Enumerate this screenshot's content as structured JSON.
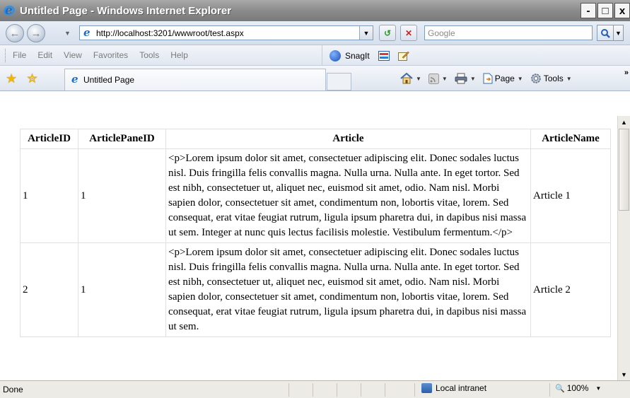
{
  "window": {
    "title": "Untitled Page - Windows Internet Explorer",
    "controls": [
      "-",
      "□",
      "x"
    ]
  },
  "address": {
    "url": "http://localhost:3201/wwwroot/test.aspx",
    "search_placeholder": "Google"
  },
  "menu": {
    "items": [
      "File",
      "Edit",
      "View",
      "Favorites",
      "Tools",
      "Help"
    ],
    "snagit": "SnagIt"
  },
  "favorites": {
    "tab_label": "Untitled Page",
    "page_label": "Page",
    "tools_label": "Tools",
    "more": "»"
  },
  "table": {
    "headers": [
      "ArticleID",
      "ArticlePaneID",
      "Article",
      "ArticleName"
    ],
    "rows": [
      {
        "id": "1",
        "pane": "1",
        "article": "<p>Lorem ipsum dolor sit amet, consectetuer adipiscing elit. Donec sodales luctus nisl. Duis fringilla felis convallis magna. Nulla urna. Nulla ante. In eget tortor. Sed est nibh, consectetuer ut, aliquet nec, euismod sit amet, odio. Nam nisl. Morbi sapien dolor, consectetuer sit amet, condimentum non, lobortis vitae, lorem. Sed consequat, erat vitae feugiat rutrum, ligula ipsum pharetra dui, in dapibus nisi massa ut sem. Integer at nunc quis lectus facilisis molestie. Vestibulum fermentum.</p>",
        "name": "Article 1"
      },
      {
        "id": "2",
        "pane": "1",
        "article": "<p>Lorem ipsum dolor sit amet, consectetuer adipiscing elit. Donec sodales luctus nisl. Duis fringilla felis convallis magna. Nulla urna. Nulla ante. In eget tortor. Sed est nibh, consectetuer ut, aliquet nec, euismod sit amet, odio. Nam nisl. Morbi sapien dolor, consectetuer sit amet, condimentum non, lobortis vitae, lorem. Sed consequat, erat vitae feugiat rutrum, ligula ipsum pharetra dui, in dapibus nisi massa ut sem.",
        "name": "Article 2"
      }
    ]
  },
  "status": {
    "text": "Done",
    "zone": "Local intranet",
    "zoom": "100%"
  }
}
